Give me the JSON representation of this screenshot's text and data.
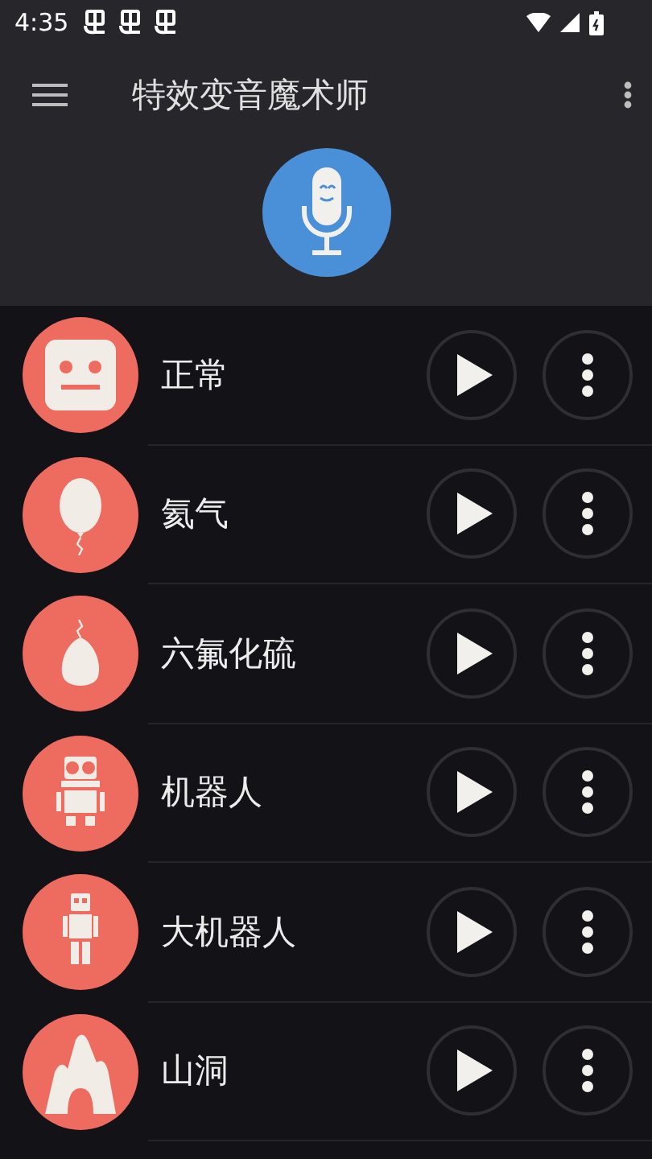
{
  "status_bar": {
    "time": "4:35"
  },
  "toolbar": {
    "title": "特效变音魔术师"
  },
  "effects": [
    {
      "name": "正常",
      "kind": "face"
    },
    {
      "name": "氦气",
      "kind": "balloon"
    },
    {
      "name": "六氟化硫",
      "kind": "heavy-balloon"
    },
    {
      "name": "机器人",
      "kind": "robot"
    },
    {
      "name": "大机器人",
      "kind": "tall-robot"
    },
    {
      "name": "山洞",
      "kind": "cave"
    }
  ]
}
